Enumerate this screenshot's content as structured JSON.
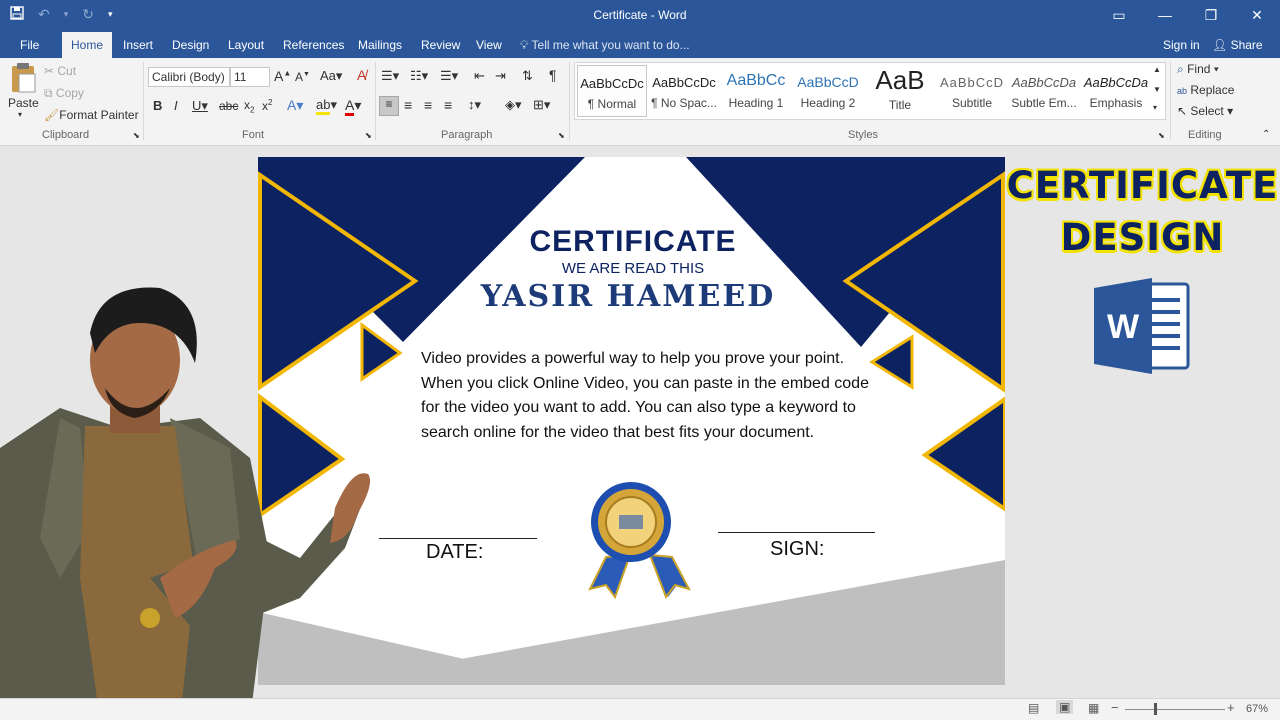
{
  "window": {
    "title": "Certificate - Word",
    "qat": {
      "save_icon": "save-icon",
      "undo_icon": "undo-icon",
      "redo_icon": "redo-icon",
      "customize": "▾"
    },
    "controls": {
      "ribbon_display": "▭",
      "minimize": "—",
      "restore": "❐",
      "close": "✕"
    }
  },
  "tabs": {
    "file": "File",
    "home": "Home",
    "insert": "Insert",
    "design": "Design",
    "layout": "Layout",
    "references": "References",
    "mailings": "Mailings",
    "review": "Review",
    "view": "View",
    "tell_me": "Tell me what you want to do...",
    "sign_in": "Sign in",
    "share": "Share"
  },
  "ribbon": {
    "clipboard": {
      "paste": "Paste",
      "cut": "Cut",
      "copy": "Copy",
      "format_painter": "Format Painter",
      "label": "Clipboard"
    },
    "font": {
      "family": "Calibri (Body)",
      "size": "11",
      "label": "Font"
    },
    "paragraph": {
      "label": "Paragraph"
    },
    "styles": {
      "label": "Styles",
      "items": [
        {
          "sample": "AaBbCcDc",
          "name": "¶ Normal"
        },
        {
          "sample": "AaBbCcDc",
          "name": "¶ No Spac..."
        },
        {
          "sample": "AaBbCc",
          "name": "Heading 1"
        },
        {
          "sample": "AaBbCcD",
          "name": "Heading 2"
        },
        {
          "sample": "AaB",
          "name": "Title"
        },
        {
          "sample": "AaBbCcD",
          "name": "Subtitle"
        },
        {
          "sample": "AaBbCcDa",
          "name": "Subtle Em..."
        },
        {
          "sample": "AaBbCcDa",
          "name": "Emphasis"
        }
      ]
    },
    "editing": {
      "find": "Find",
      "replace": "Replace",
      "select": "Select",
      "label": "Editing"
    }
  },
  "certificate": {
    "title": "CERTIFICATE",
    "subtitle": "WE ARE READ THIS",
    "name": "YASIR HAMEED",
    "body": "Video provides a powerful way to help you prove your point. When you click Online Video, you can paste in the embed code for the video you want to add. You can also type a keyword to search online for the video that best fits your document.",
    "date_label": "DATE:",
    "sign_label": "SIGN:",
    "colors": {
      "navy": "#0d2261",
      "gold": "#f2b705",
      "ribbon_blue": "#2a5bb8"
    }
  },
  "overlay": {
    "line1": "CERTIFICATE",
    "line2": "DESIGN",
    "logo": "W"
  },
  "statusbar": {
    "zoom": "67%"
  }
}
